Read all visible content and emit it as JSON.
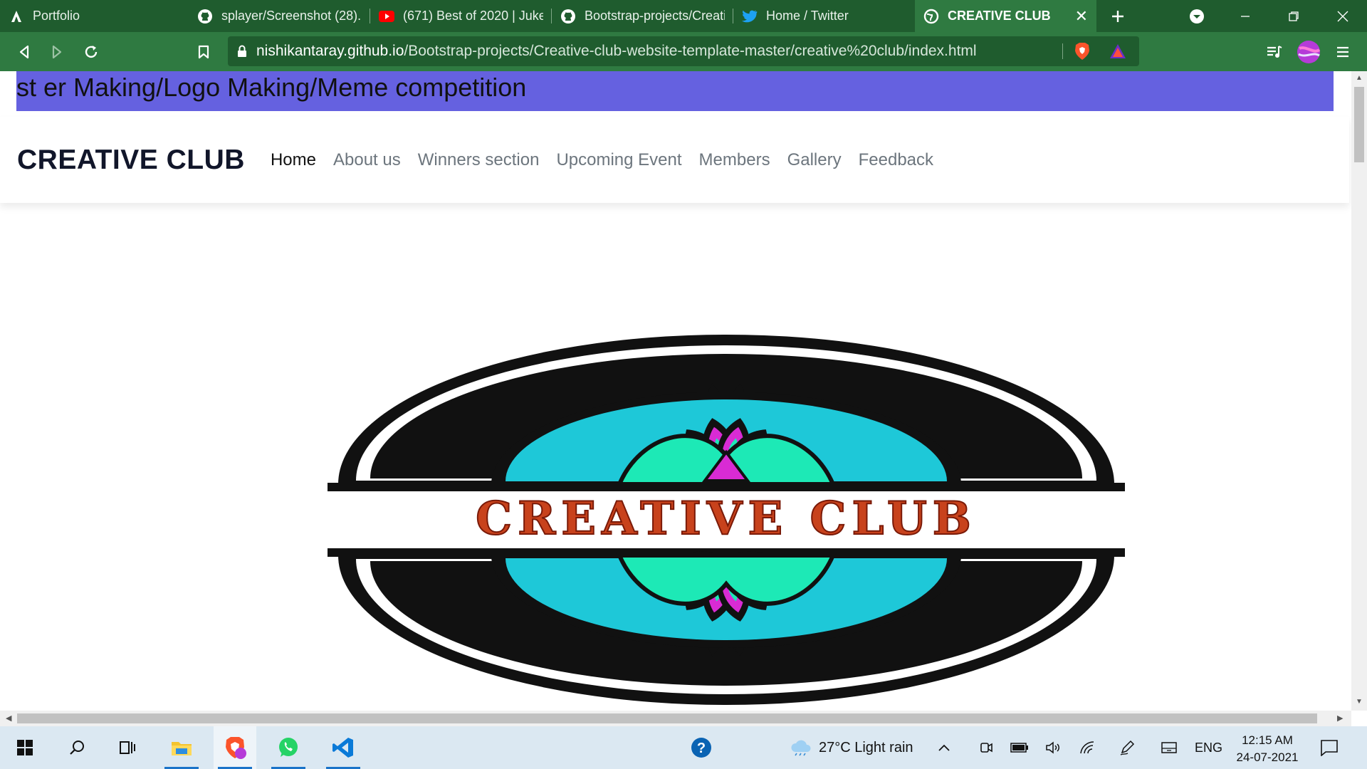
{
  "tabs": [
    {
      "label": "Portfolio",
      "icon": "a-logo-icon"
    },
    {
      "label": "splayer/Screenshot (28).p",
      "icon": "github-icon"
    },
    {
      "label": "(671) Best of 2020 | Jukeb",
      "icon": "youtube-icon"
    },
    {
      "label": "Bootstrap-projects/Creati",
      "icon": "github-icon"
    },
    {
      "label": "Home / Twitter",
      "icon": "twitter-icon"
    },
    {
      "label": "CREATIVE CLUB",
      "icon": "globe-icon",
      "active": true
    }
  ],
  "address": {
    "host": "nishikantaray.github.io",
    "path": "/Bootstrap-projects/Creative-club-website-template-master/creative%20club/index.html"
  },
  "page": {
    "marquee": "st er Making/Logo Making/Meme competition",
    "brand": "CREATIVE CLUB",
    "nav": [
      "Home",
      "About us",
      "Winners section",
      "Upcoming Event",
      "Members",
      "Gallery",
      "Feedback"
    ],
    "hero_logo_text": "CREATIVE CLUB"
  },
  "taskbar": {
    "weather": "27°C  Light rain",
    "language": "ENG",
    "time": "12:15 AM",
    "date": "24-07-2021"
  },
  "colors": {
    "tabbar": "#1f5c2e",
    "active_tab": "#2f7a41",
    "marquee_bg": "#6561e0",
    "brand_text": "#11162a",
    "nav_inactive": "#6c757d",
    "hero_text": "#c8421c"
  }
}
